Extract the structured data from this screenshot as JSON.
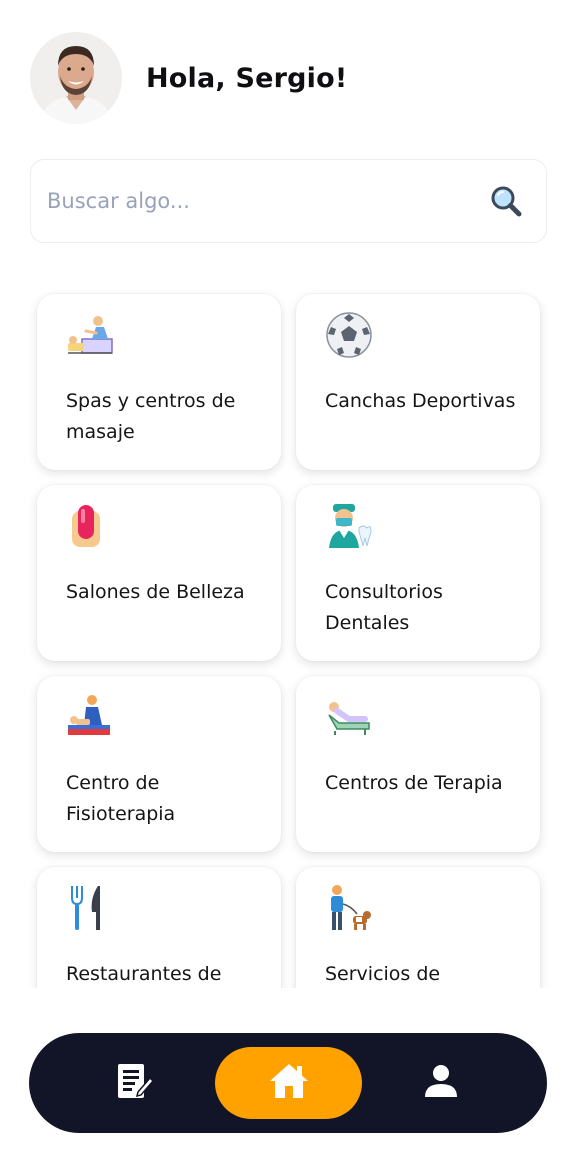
{
  "header": {
    "greeting": "Hola, Sergio!"
  },
  "search": {
    "placeholder": "Buscar algo..."
  },
  "categories": [
    {
      "label": "Spas y centros de masaje",
      "icon": "massage-icon"
    },
    {
      "label": "Canchas Deportivas",
      "icon": "soccer-ball-icon"
    },
    {
      "label": "Salones de Belleza",
      "icon": "nail-icon"
    },
    {
      "label": "Consultorios Dentales",
      "icon": "dentist-icon"
    },
    {
      "label": "Centro de Fisioterapia",
      "icon": "physiotherapy-icon"
    },
    {
      "label": "Centros de Terapia",
      "icon": "therapy-couch-icon"
    },
    {
      "label": "Restaurantes de",
      "icon": "fork-knife-icon"
    },
    {
      "label": "Servicios de",
      "icon": "dog-walker-icon"
    }
  ],
  "nav": {
    "items": [
      "notes-icon",
      "home-icon",
      "profile-icon"
    ],
    "active": "home-icon",
    "active_color": "#ffa200",
    "bar_color": "#111527"
  }
}
